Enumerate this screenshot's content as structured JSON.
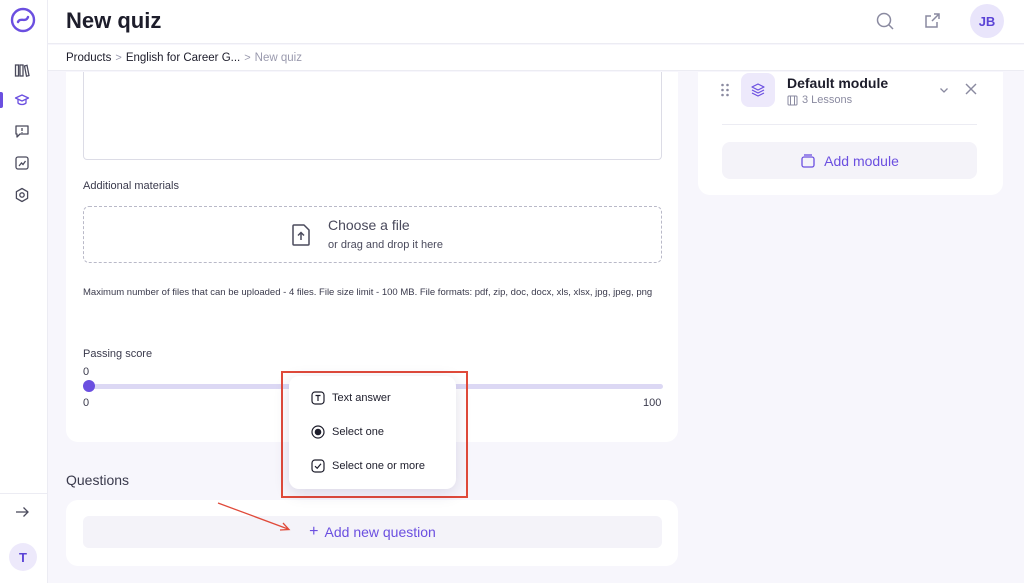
{
  "header": {
    "title": "New quiz",
    "avatar": "JB"
  },
  "breadcrumb": {
    "items": [
      "Products",
      "English for Career G...",
      "New quiz"
    ],
    "separator": ">"
  },
  "sidebar": {
    "items": [
      {
        "icon": "library-icon"
      },
      {
        "icon": "graduation-cap-icon",
        "active": true
      },
      {
        "icon": "message-alert-icon"
      },
      {
        "icon": "analytics-icon"
      },
      {
        "icon": "settings-hex-icon"
      }
    ],
    "collapse_icon": "arrow-right-icon",
    "avatar": "T"
  },
  "form": {
    "additional_materials_label": "Additional materials",
    "dropzone": {
      "title": "Choose a file",
      "subtitle": "or drag and drop it here"
    },
    "hint": "Maximum number of files that can be uploaded - 4 files. File size limit - 100 MB. File formats: pdf, zip, doc, docx, xls, xlsx, jpg, jpeg, png",
    "passing_score": {
      "label": "Passing score",
      "value": "0",
      "min": "0",
      "max": "100",
      "fraction": 0
    }
  },
  "questions": {
    "title": "Questions",
    "add_label": "Add new question",
    "menu": [
      {
        "label": "Text answer",
        "icon": "text-box-icon"
      },
      {
        "label": "Select one",
        "icon": "radio-icon"
      },
      {
        "label": "Select one or more",
        "icon": "checkbox-icon"
      }
    ]
  },
  "modules": {
    "item": {
      "title": "Default module",
      "subtitle": "3 Lessons"
    },
    "add_label": "Add module"
  },
  "colors": {
    "accent": "#6b4fe0",
    "annotation": "#e04a3a"
  }
}
